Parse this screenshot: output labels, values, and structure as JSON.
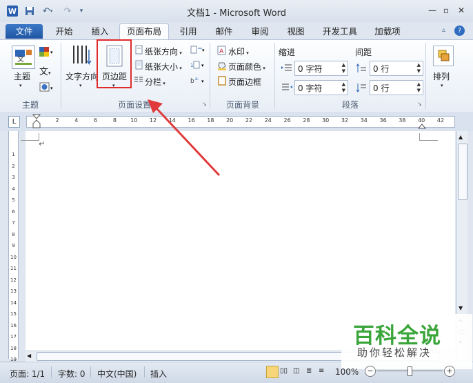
{
  "window": {
    "title": "文档1 - Microsoft Word",
    "app_icon_letter": "W"
  },
  "quick_access": {
    "save_icon": "save-icon",
    "undo_icon": "undo-icon",
    "redo_icon": "redo-icon",
    "customize_icon": "customize-qat-icon"
  },
  "tabs": [
    {
      "label": "文件"
    },
    {
      "label": "开始"
    },
    {
      "label": "插入"
    },
    {
      "label": "页面布局"
    },
    {
      "label": "引用"
    },
    {
      "label": "邮件"
    },
    {
      "label": "审阅"
    },
    {
      "label": "视图"
    },
    {
      "label": "开发工具"
    },
    {
      "label": "加载项"
    }
  ],
  "ribbon": {
    "themes": {
      "theme_label": "主题",
      "group_label": "主题"
    },
    "page_setup": {
      "text_direction_label": "文字方向",
      "margins_label": "页边距",
      "orientation_label": "纸张方向",
      "size_label": "纸张大小",
      "columns_label": "分栏",
      "group_label": "页面设置"
    },
    "page_background": {
      "watermark_label": "水印",
      "page_color_label": "页面颜色",
      "page_borders_label": "页面边框",
      "group_label": "页面背景"
    },
    "paragraph": {
      "indent_label": "缩进",
      "spacing_label": "间距",
      "indent_left_value": "0 字符",
      "indent_right_value": "0 字符",
      "spacing_before_value": "0 行",
      "spacing_after_value": "0 行",
      "group_label": "段落"
    },
    "arrange": {
      "label": "排列"
    }
  },
  "ruler": {
    "ticks": [
      "2",
      "4",
      "6",
      "8",
      "10",
      "12",
      "14",
      "16",
      "18",
      "20",
      "22",
      "24",
      "26",
      "28",
      "30",
      "32",
      "34",
      "36",
      "38",
      "40",
      "42"
    ],
    "vticks": [
      "1",
      "2",
      "3",
      "4",
      "5",
      "6",
      "7",
      "8",
      "9",
      "10",
      "11",
      "12",
      "13",
      "14",
      "15",
      "16",
      "17",
      "18",
      "19"
    ]
  },
  "document": {
    "paragraph_mark": "↵"
  },
  "status_bar": {
    "page": "页面: 1/1",
    "words": "字数: 0",
    "language": "中文(中国)",
    "insert_mode": "插入",
    "zoom": "100%"
  },
  "watermark": {
    "title": "百科全说",
    "subtitle": "助你轻松解决"
  },
  "colors": {
    "file_tab": "#2a63b0",
    "highlight_box": "#e02a2a",
    "arrow": "#e03a3a",
    "watermark_green": "#3aa53a"
  }
}
